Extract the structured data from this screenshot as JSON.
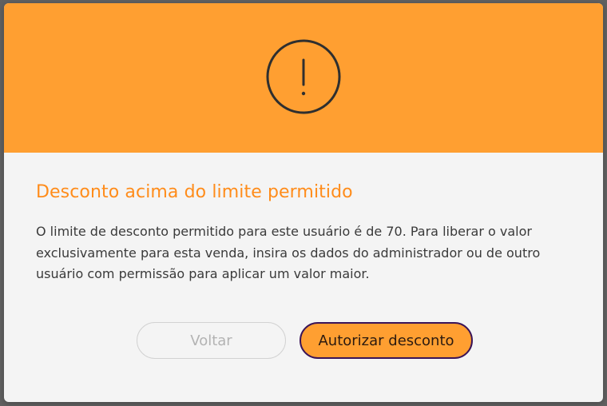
{
  "dialog": {
    "icon": "exclamation-circle-icon",
    "title": "Desconto acima do limite permitido",
    "message": "O limite de desconto permitido para este usuário é de 70. Para liberar o valor exclusivamente para esta venda, insira os dados do administrador ou de outro usuário com permissão para aplicar um valor maior.",
    "buttons": {
      "back_label": "Voltar",
      "authorize_label": "Autorizar desconto"
    }
  },
  "colors": {
    "header_bg": "#ff9f31",
    "title": "#ff8c1a",
    "body_bg": "#f4f4f4",
    "primary_button": "#ff9f31",
    "primary_button_border": "#3a1458",
    "backdrop": "#616161"
  }
}
